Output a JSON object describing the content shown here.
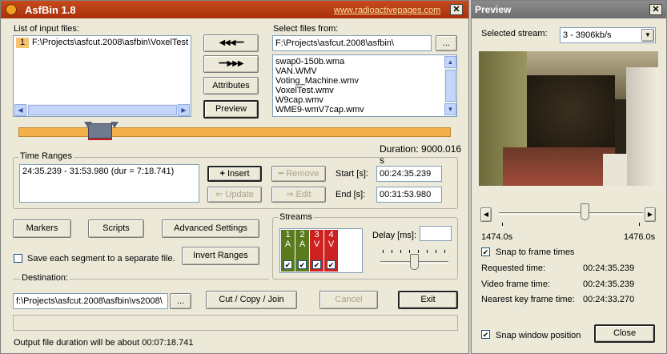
{
  "main": {
    "title": "AsfBin 1.8",
    "link": "www.radioactivepages.com",
    "close_glyph": "✕",
    "input_files_label": "List of input files:",
    "input_files": [
      {
        "num": "1",
        "path": "F:\\Projects\\asfcut.2008\\asfbin\\VoxelTest"
      }
    ],
    "select_files_label": "Select files from:",
    "select_path": "F:\\Projects\\asfcut.2008\\asfbin\\",
    "browse_label": "...",
    "file_list": [
      "swap0-150b.wma",
      "VAN.WMV",
      "Voting_Machine.wmv",
      "VoxelTest.wmv",
      "W9cap.wmv",
      "WME9-wmV7cap.wmv"
    ],
    "move_left_glyph": "◀◀◀━━",
    "move_right_glyph": "━━▶▶▶",
    "attributes_label": "Attributes",
    "preview_label": "Preview",
    "duration_text": "Duration: 9000.016 s",
    "time_ranges_label": "Time Ranges",
    "time_range_entry": "24:35.239 - 31:53.980  (dur = 7:18.741)",
    "insert_label": "Insert",
    "remove_label": "Remove",
    "update_label": "Update",
    "edit_label": "Edit",
    "start_label": "Start [s]:",
    "start_value": "00:24:35.239",
    "end_label": "End [s]:",
    "end_value": "00:31:53.980",
    "markers_label": "Markers",
    "scripts_label": "Scripts",
    "advanced_label": "Advanced Settings",
    "save_segments_label": "Save each segment to a separate file.",
    "invert_label": "Invert Ranges",
    "streams_label": "Streams",
    "streams": [
      {
        "num": "1",
        "type": "A",
        "color": "#5a7a1e"
      },
      {
        "num": "2",
        "type": "A",
        "color": "#5a7a1e"
      },
      {
        "num": "3",
        "type": "V",
        "color": "#cc2222"
      },
      {
        "num": "4",
        "type": "V",
        "color": "#cc2222"
      }
    ],
    "check_glyph": "✔",
    "delay_label": "Delay [ms]:",
    "delay_value": "",
    "destination_label": "Destination:",
    "destination_path": "f:\\Projects\\asfcut.2008\\asfbin\\vs2008\\",
    "cut_label": "Cut / Copy / Join",
    "cancel_label": "Cancel",
    "exit_label": "Exit",
    "status_text": "Output file duration will be about 00:07:18.741"
  },
  "preview": {
    "title": "Preview",
    "close_glyph": "✕",
    "stream_label": "Selected stream:",
    "stream_value": "3 - 3906kb/s",
    "range_start": "1474.0s",
    "range_end": "1476.0s",
    "snap_frame_label": "Snap to frame times",
    "requested_label": "Requested time:",
    "requested_value": "00:24:35.239",
    "video_frame_label": "Video frame time:",
    "video_frame_value": "00:24:35.239",
    "nearest_key_label": "Nearest key frame time:",
    "nearest_key_value": "00:24:33.270",
    "snap_window_label": "Snap window position",
    "close_label": "Close"
  },
  "colors": {
    "accent_red": "#b8380f",
    "timeline_orange": "#f4b04a"
  }
}
